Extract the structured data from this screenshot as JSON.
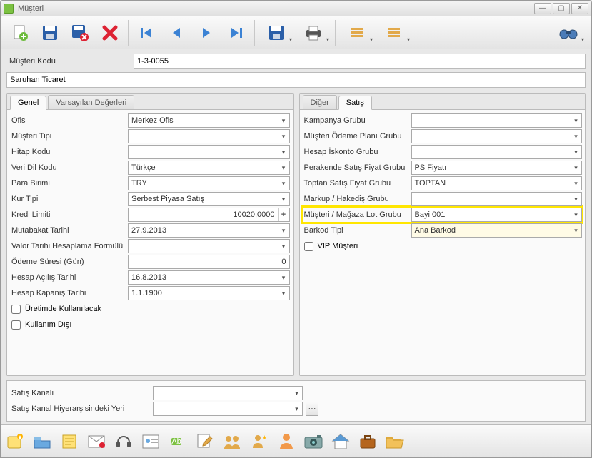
{
  "window": {
    "title": "Müşteri"
  },
  "header": {
    "code_label": "Müşteri Kodu",
    "code_value": "1-3-0055",
    "customer_name": "Saruhan Ticaret"
  },
  "left": {
    "tabs": [
      "Genel",
      "Varsayılan Değerleri"
    ],
    "active": 0,
    "fields": {
      "ofis_l": "Ofis",
      "ofis_v": "Merkez Ofis",
      "musteri_tipi_l": "Müşteri Tipi",
      "musteri_tipi_v": "",
      "hitap_l": "Hitap Kodu",
      "hitap_v": "",
      "veridil_l": "Veri Dil Kodu",
      "veridil_v": "Türkçe",
      "para_l": "Para Birimi",
      "para_v": "TRY",
      "kur_l": "Kur Tipi",
      "kur_v": "Serbest Piyasa Satış",
      "kredi_l": "Kredi Limiti",
      "kredi_v": "10020,0000",
      "mutabakat_l": "Mutabakat Tarihi",
      "mutabakat_v": "27.9.2013",
      "valor_l": "Valor Tarihi Hesaplama Formülü",
      "valor_v": "",
      "odeme_l": "Ödeme Süresi (Gün)",
      "odeme_v": "0",
      "acilis_l": "Hesap Açılış Tarihi",
      "acilis_v": "16.8.2013",
      "kapanis_l": "Hesap Kapanış Tarihi",
      "kapanis_v": "1.1.1900",
      "uretimde_l": "Üretimde Kullanılacak",
      "kullanim_l": "Kullanım Dışı"
    }
  },
  "right": {
    "tabs": [
      "Diğer",
      "Satış"
    ],
    "active": 1,
    "fields": {
      "kampanya_l": "Kampanya Grubu",
      "kampanya_v": "",
      "odeme_plan_l": "Müşteri Ödeme Planı Grubu",
      "odeme_plan_v": "",
      "iskonto_l": "Hesap İskonto Grubu",
      "iskonto_v": "",
      "perakende_l": "Perakende Satış Fiyat Grubu",
      "perakende_v": "PS Fiyatı",
      "toptan_l": "Toptan Satış Fiyat Grubu",
      "toptan_v": "TOPTAN",
      "markup_l": "Markup / Hakediş Grubu",
      "markup_v": "",
      "lot_l": "Müşteri / Mağaza Lot Grubu",
      "lot_v": "Bayi 001",
      "barkod_l": "Barkod Tipi",
      "barkod_v": "Ana Barkod",
      "vip_l": "VIP Müşteri"
    }
  },
  "bottom": {
    "kanal_l": "Satış Kanalı",
    "kanal_v": "",
    "hier_l": "Satış Kanal Hiyerarşisindeki Yeri",
    "hier_v": ""
  }
}
